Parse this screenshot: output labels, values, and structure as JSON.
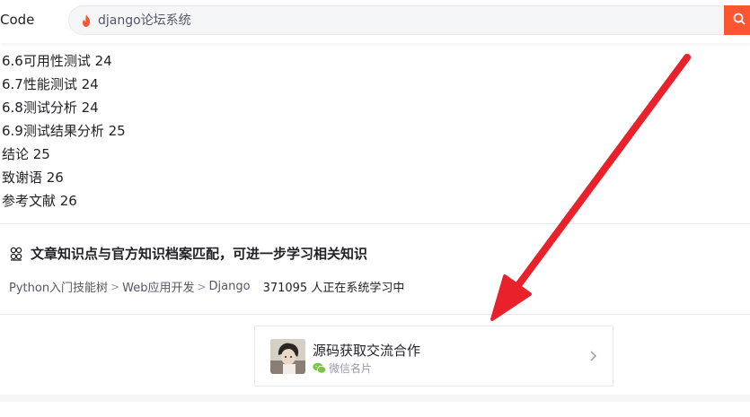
{
  "header": {
    "brand_text": "Code",
    "search_placeholder": "django论坛系统",
    "accent_color": "#fc5531"
  },
  "toc": {
    "items": [
      "6.6可用性测试 24",
      "6.7性能测试 24",
      "6.8测试分析 24",
      "6.9测试结果分析 25",
      "结论 25",
      "致谢语 26",
      "参考文献 26"
    ]
  },
  "knowledge": {
    "title": "文章知识点与官方知识档案匹配，可进一步学习相关知识",
    "path": [
      "Python入门技能树",
      "Web应用开发",
      "Django"
    ],
    "learners": "371095 人正在系统学习中"
  },
  "card": {
    "title": "源码获取交流合作",
    "subtitle": "微信名片"
  },
  "icons": {
    "search": "flame-icon",
    "knowledge": "knowledge-icon",
    "wechat": "wechat-icon",
    "chevron": "chevron-right-icon"
  },
  "annotation": {
    "arrow_color": "#e8212a"
  }
}
